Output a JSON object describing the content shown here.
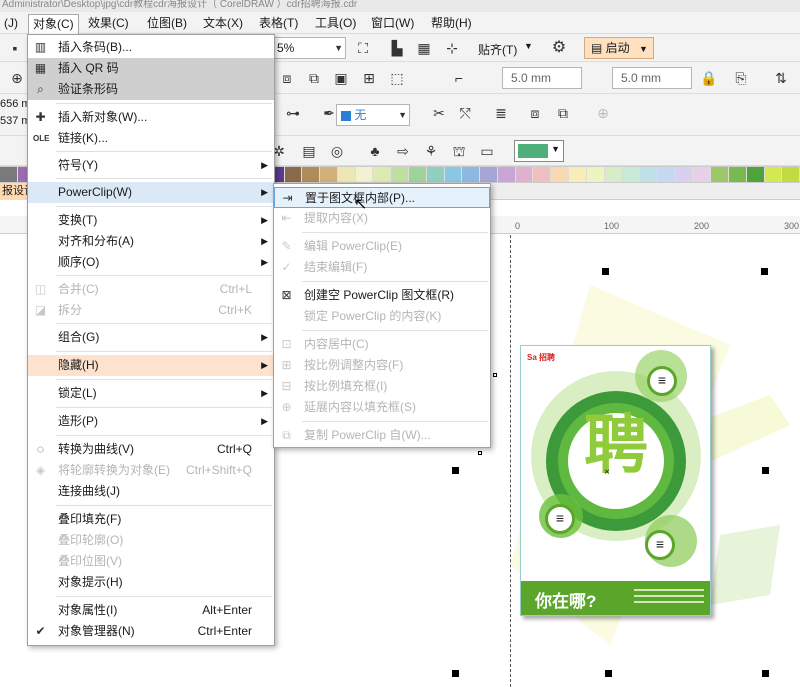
{
  "title_bar": "Administrator\\Desktop\\jpg\\cdr教程cdr海报设计（ CorelDRAW ）cdr招聘海报.cdr",
  "menubar": {
    "items": [
      "(J)",
      "对象(C)",
      "效果(C)",
      "位图(B)",
      "文本(X)",
      "表格(T)",
      "工具(O)",
      "窗口(W)",
      "帮助(H)"
    ]
  },
  "toolbar": {
    "zoom_value": "5%",
    "snap_label": "贴齐(T)",
    "start_label": "启动",
    "width_value": "5.0 mm",
    "height_value": "5.0 mm",
    "fill_value": "无",
    "left_coords": [
      "656 m",
      "537 m"
    ]
  },
  "doc_tab": "报设计",
  "ruler": {
    "ticks": [
      "0",
      "100",
      "200",
      "300"
    ]
  },
  "palette_colors": [
    "#7a7a7a",
    "#9a6cb0",
    "#c24a9c",
    "#d12a6a",
    "#d9342b",
    "#e5742a",
    "#f0c43a",
    "#f6ea4a",
    "#b8d23a",
    "#6cbf3b",
    "#2e9b4b",
    "#1a8a7a",
    "#1f7fb3",
    "#2b5fa8",
    "#3a3f8f",
    "#5b3a8c",
    "#8a6a4a",
    "#b08b5a",
    "#d1b07a",
    "#efe6b5",
    "#f2f2d0",
    "#dcebb0",
    "#bfe0a0",
    "#9fd39a",
    "#8fcfc0",
    "#88c8e0",
    "#8fb8e0",
    "#a6a6d6",
    "#c7a6d6",
    "#e0b0cf",
    "#f0c0c0",
    "#f8d8b0",
    "#f8ecb8",
    "#eef4c0",
    "#d8ecc8",
    "#c8e8d8",
    "#c0e0e8",
    "#c8d8f0",
    "#d8d0f0",
    "#e8d0e8",
    "#9cc86a",
    "#7ab850",
    "#4ea33a",
    "#d4e850",
    "#c0dc40"
  ],
  "object_menu": {
    "items": [
      {
        "label": "插入条码(B)...",
        "shortcut": "",
        "sub": false,
        "disabled": false,
        "icon": "barcode-icon",
        "glyph": "▥"
      },
      {
        "label": "插入 QR 码",
        "shortcut": "",
        "sub": false,
        "disabled": false,
        "icon": "qr-code-icon",
        "glyph": "▦"
      },
      {
        "label": "验证条形码",
        "shortcut": "",
        "sub": false,
        "disabled": false,
        "icon": "verify-barcode-icon",
        "glyph": "⌕"
      },
      {
        "label": "插入新对象(W)...",
        "shortcut": "",
        "sub": false,
        "disabled": false,
        "icon": "insert-object-icon",
        "glyph": "✚"
      },
      {
        "label": "链接(K)...",
        "shortcut": "",
        "sub": false,
        "disabled": false,
        "icon": "ole-icon",
        "glyph": "OLE"
      },
      {
        "label": "符号(Y)",
        "shortcut": "",
        "sub": true,
        "disabled": false
      },
      {
        "label": "PowerClip(W)",
        "shortcut": "",
        "sub": true,
        "disabled": false
      },
      {
        "label": "变换(T)",
        "shortcut": "",
        "sub": true,
        "disabled": false
      },
      {
        "label": "对齐和分布(A)",
        "shortcut": "",
        "sub": true,
        "disabled": false
      },
      {
        "label": "顺序(O)",
        "shortcut": "",
        "sub": true,
        "disabled": false
      },
      {
        "label": "合并(C)",
        "shortcut": "Ctrl+L",
        "sub": false,
        "disabled": true,
        "icon": "combine-icon",
        "glyph": "◫"
      },
      {
        "label": "拆分",
        "shortcut": "Ctrl+K",
        "sub": false,
        "disabled": true,
        "icon": "break-apart-icon",
        "glyph": "◪"
      },
      {
        "label": "组合(G)",
        "shortcut": "",
        "sub": true,
        "disabled": false
      },
      {
        "label": "隐藏(H)",
        "shortcut": "",
        "sub": true,
        "disabled": false
      },
      {
        "label": "锁定(L)",
        "shortcut": "",
        "sub": true,
        "disabled": false
      },
      {
        "label": "造形(P)",
        "shortcut": "",
        "sub": true,
        "disabled": false
      },
      {
        "label": "转换为曲线(V)",
        "shortcut": "Ctrl+Q",
        "sub": false,
        "disabled": false,
        "icon": "convert-to-curves-icon",
        "glyph": "◌"
      },
      {
        "label": "将轮廓转换为对象(E)",
        "shortcut": "Ctrl+Shift+Q",
        "sub": false,
        "disabled": true,
        "icon": "outline-to-object-icon",
        "glyph": "◈"
      },
      {
        "label": "连接曲线(J)",
        "shortcut": "",
        "sub": false,
        "disabled": false
      },
      {
        "label": "叠印填充(F)",
        "shortcut": "",
        "sub": false,
        "disabled": false
      },
      {
        "label": "叠印轮廓(O)",
        "shortcut": "",
        "sub": false,
        "disabled": true
      },
      {
        "label": "叠印位图(V)",
        "shortcut": "",
        "sub": false,
        "disabled": true
      },
      {
        "label": "对象提示(H)",
        "shortcut": "",
        "sub": false,
        "disabled": false
      },
      {
        "label": "对象属性(I)",
        "shortcut": "Alt+Enter",
        "sub": false,
        "disabled": false
      },
      {
        "label": "对象管理器(N)",
        "shortcut": "Ctrl+Enter",
        "sub": false,
        "disabled": false,
        "icon": "check-icon",
        "glyph": "✔"
      }
    ]
  },
  "powerclip_menu": {
    "items": [
      {
        "label": "置于图文框内部(P)...",
        "disabled": false,
        "icon": "place-inside-frame-icon",
        "glyph": "⇥"
      },
      {
        "label": "提取内容(X)",
        "disabled": true,
        "icon": "extract-contents-icon",
        "glyph": "⇤"
      },
      {
        "label": "编辑 PowerClip(E)",
        "disabled": true,
        "icon": "edit-powerclip-icon",
        "glyph": "✎"
      },
      {
        "label": "结束编辑(F)",
        "disabled": true,
        "icon": "finish-editing-icon",
        "glyph": "✓"
      },
      {
        "label": "创建空 PowerClip 图文框(R)",
        "disabled": false,
        "icon": "create-empty-frame-icon",
        "glyph": "⊠"
      },
      {
        "label": "锁定 PowerClip 的内容(K)",
        "disabled": true,
        "icon": "",
        "glyph": ""
      },
      {
        "label": "内容居中(C)",
        "disabled": true,
        "icon": "center-content-icon",
        "glyph": "⊡"
      },
      {
        "label": "按比例调整内容(F)",
        "disabled": true,
        "icon": "fit-content-icon",
        "glyph": "⊞"
      },
      {
        "label": "按比例填充框(I)",
        "disabled": true,
        "icon": "fill-frame-icon",
        "glyph": "⊟"
      },
      {
        "label": "延展内容以填充框(S)",
        "disabled": true,
        "icon": "stretch-content-icon",
        "glyph": "⊕"
      },
      {
        "label": "复制 PowerClip 自(W)...",
        "disabled": true,
        "icon": "copy-powerclip-icon",
        "glyph": "⧉"
      }
    ]
  },
  "poster": {
    "big_char": "聘",
    "question": "你在哪?",
    "logo_text": "Sa 招聘"
  }
}
